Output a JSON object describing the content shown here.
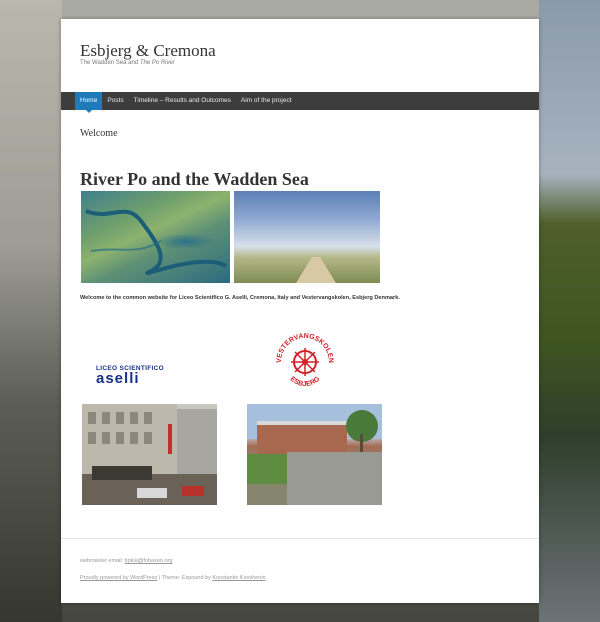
{
  "site": {
    "title": "Esbjerg & Cremona",
    "description_prefix": "The Wadden Sea and ",
    "description_italic": "The Po River"
  },
  "nav": {
    "items": [
      {
        "label": "Home",
        "active": true
      },
      {
        "label": "Posts",
        "active": false
      },
      {
        "label": "Timeline – Results and Outcomes",
        "active": false
      },
      {
        "label": "Aim of the project",
        "active": false
      }
    ]
  },
  "main": {
    "page_heading": "Welcome",
    "post_title": "River Po and the Wadden Sea",
    "welcome_text": "Welcome to the common website for Liceo Scientifico G. Aselli, Cremona, Italy and Vestervangskolen, Esbjerg Denmark."
  },
  "logos": {
    "aselli_line1": "LICEO SCIENTIFICO",
    "aselli_line2": "aselli",
    "vest_top": "VESTERVANGSKOLEN",
    "vest_bottom": "ESBJERG"
  },
  "footer": {
    "email_label": "webmaster email: ",
    "email": "bpkla@fobasen.org",
    "credit_link": "Proudly powered by WordPress",
    "credit_sep": " | Theme: Expound by ",
    "credit_author": "Konstantin Kovshenin"
  },
  "colors": {
    "nav_background": "#3d3d3d",
    "nav_active": "#1e7ab8",
    "logo_blue": "#18318c",
    "logo_red": "#d3202a"
  }
}
